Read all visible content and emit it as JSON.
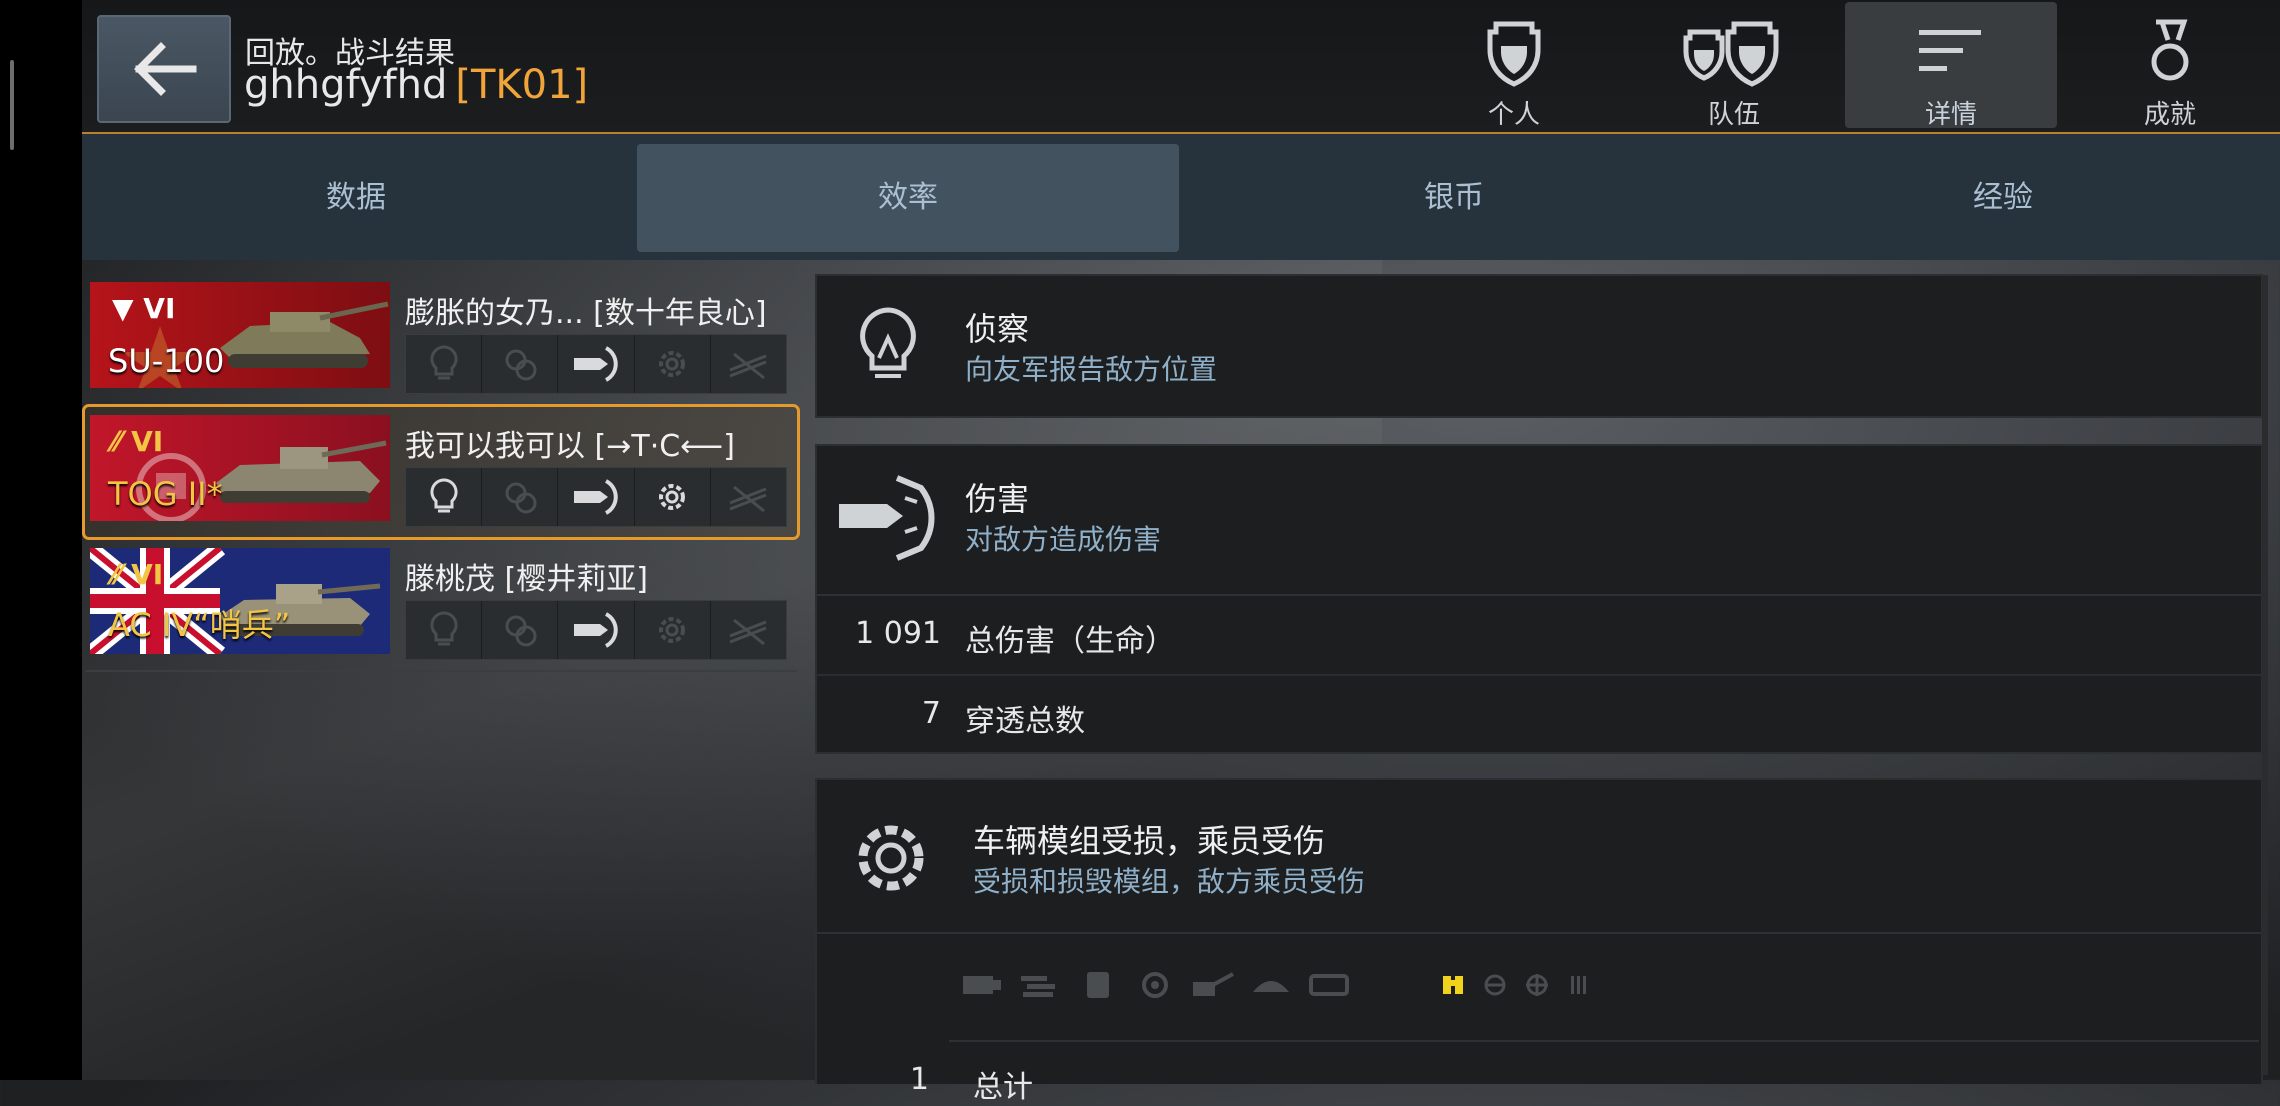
{
  "header": {
    "back_label": "back",
    "title": "回放。战斗结果",
    "player_name": "ghhgfyfhd",
    "clan_tag": "[TK01]",
    "nav": [
      {
        "label": "个人",
        "icon": "soldier-icon",
        "active": false
      },
      {
        "label": "队伍",
        "icon": "team-icon",
        "active": false
      },
      {
        "label": "详情",
        "icon": "details-icon",
        "active": true
      },
      {
        "label": "成就",
        "icon": "medal-icon",
        "active": false
      }
    ]
  },
  "tabs": [
    {
      "label": "数据",
      "active": false
    },
    {
      "label": "效率",
      "active": true
    },
    {
      "label": "银币",
      "active": false
    },
    {
      "label": "经验",
      "active": false
    }
  ],
  "vehicles": [
    {
      "tier": "VI",
      "name": "SU-100",
      "player": "膨胀的女乃... [数十年良心]",
      "flag_color": "#b5141a",
      "selected": false,
      "active_slots": [
        false,
        false,
        true,
        false,
        false
      ]
    },
    {
      "tier": "VI",
      "name": "TOG II*",
      "player": "我可以我可以 [→T·C⟵]",
      "flag_color": "#c2162a",
      "selected": true,
      "active_slots": [
        true,
        false,
        true,
        true,
        false
      ]
    },
    {
      "tier": "VI",
      "name": "AC IV“哨兵”",
      "player": "滕桃茂 [樱井莉亚]",
      "flag_color": "#1c2a78",
      "selected": false,
      "active_slots": [
        false,
        false,
        true,
        false,
        false
      ]
    }
  ],
  "panels": {
    "recon": {
      "title": "侦察",
      "subtitle": "向友军报告敌方位置",
      "icon": "lightbulb-icon"
    },
    "damage": {
      "title": "伤害",
      "subtitle": "对敌方造成伤害",
      "icon": "shell-icon",
      "stats": [
        {
          "value": "1 091",
          "label": "总伤害（生命）"
        },
        {
          "value": "7",
          "label": "穿透总数"
        }
      ]
    },
    "modules": {
      "title": "车辆模组受损，乘员受伤",
      "subtitle": "受损和损毁模组，敌方乘员受伤",
      "icon": "gear-icon",
      "module_icons": [
        "engine-icon",
        "transmission-icon",
        "fuel-tank-icon",
        "ammo-rack-icon",
        "gun-icon",
        "turret-icon",
        "tracks-icon"
      ],
      "crew_icons": [
        "binoculars-icon",
        "driver-icon",
        "gunner-icon",
        "loader-icon"
      ],
      "total_row": {
        "value": "1",
        "label": "总计"
      }
    }
  }
}
